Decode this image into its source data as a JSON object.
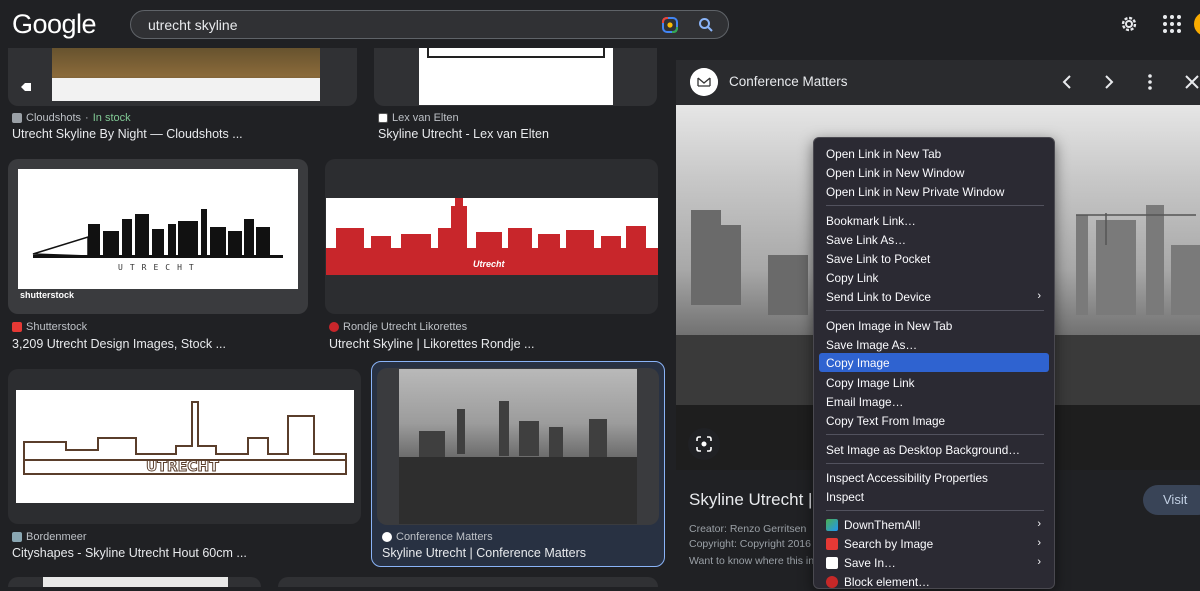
{
  "header": {
    "logo": "Google",
    "search_value": "utrecht skyline"
  },
  "results": [
    {
      "source": "Cloudshots",
      "stock": "In stock",
      "title": "Utrecht Skyline By Night — Cloudshots ..."
    },
    {
      "source": "Lex van Elten",
      "title": "Skyline Utrecht - Lex van Elten"
    },
    {
      "source": "Shutterstock",
      "title": "3,209 Utrecht Design Images, Stock ...",
      "watermark": "shutterstock",
      "image_text": "UTRECHT"
    },
    {
      "source": "Rondje Utrecht Likorettes",
      "title": "Utrecht Skyline | Likorettes Rondje ...",
      "image_text": "Utrecht"
    },
    {
      "source": "Bordenmeer",
      "title": "Cityshapes - Skyline Utrecht Hout 60cm ...",
      "image_text": "UTRECHT"
    },
    {
      "source": "Conference Matters",
      "title": "Skyline Utrecht | Conference Matters"
    }
  ],
  "panel": {
    "site_name": "Conference Matters",
    "title": "Skyline Utrecht | C",
    "creator": "Creator: Renzo Gerritsen",
    "copyright": "Copyright: Copyright 2016",
    "desc": "Want to know where this in",
    "visit_label": "Visit"
  },
  "context_menu": {
    "items": [
      "Open Link in New Tab",
      "Open Link in New Window",
      "Open Link in New Private Window",
      "Bookmark Link…",
      "Save Link As…",
      "Save Link to Pocket",
      "Copy Link",
      "Send Link to Device",
      "Open Image in New Tab",
      "Save Image As…",
      "Copy Image",
      "Copy Image Link",
      "Email Image…",
      "Copy Text From Image",
      "Set Image as Desktop Background…",
      "Inspect Accessibility Properties",
      "Inspect",
      "DownThemAll!",
      "Search by Image",
      "Save In…",
      "Block element…"
    ],
    "highlighted": "Copy Image",
    "submenu_arrow": "›"
  },
  "colors": {
    "accent": "#8ab4f8",
    "stock_green": "#81c995",
    "menu_highlight": "#2f63d0",
    "likorettes_red": "#c8262b"
  }
}
